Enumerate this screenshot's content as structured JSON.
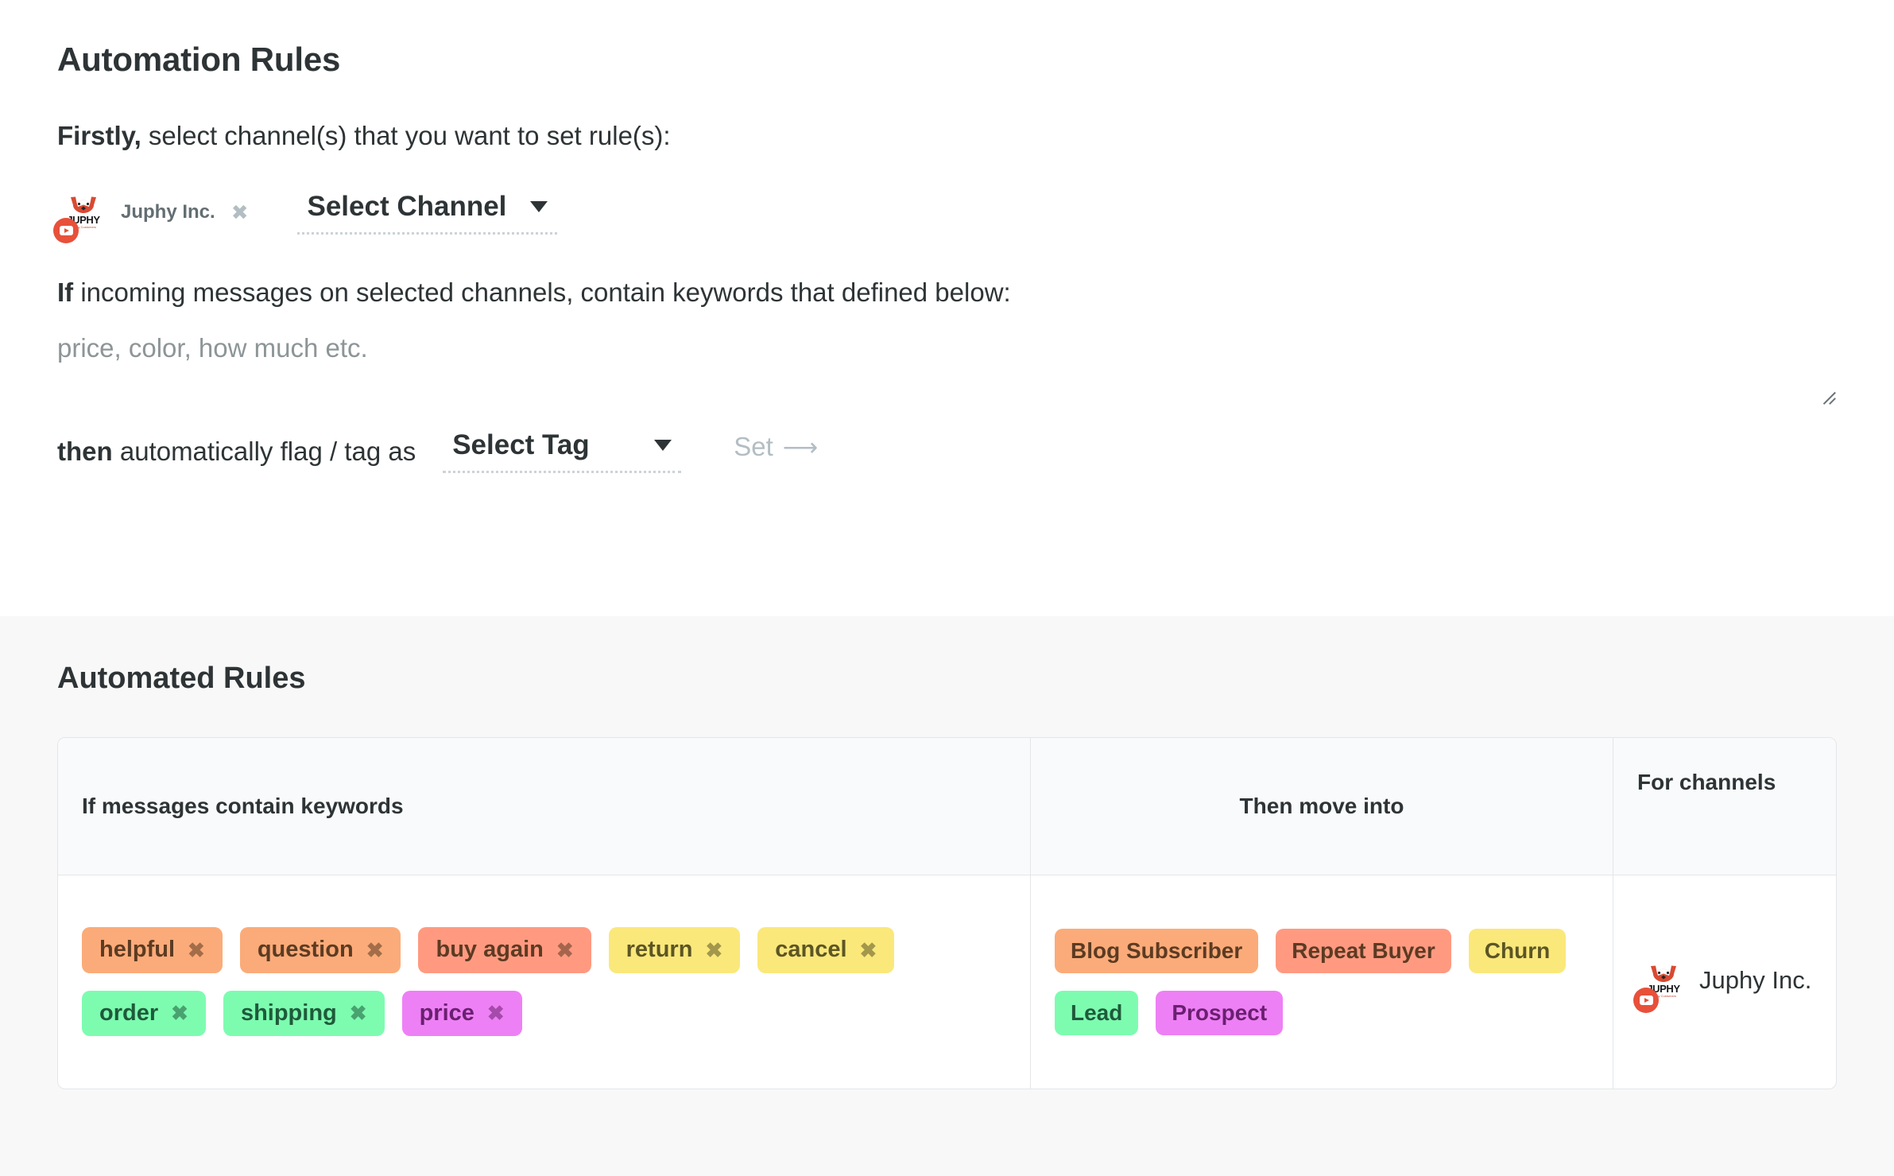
{
  "builder": {
    "title": "Automation Rules",
    "firstly": {
      "lead": "Firstly,",
      "rest": " select channel(s) that you want to set rule(s):"
    },
    "selected_channel": {
      "name": "Juphy Inc.",
      "remove_icon": "close-icon",
      "platform": "youtube",
      "logo_wordmark": "JUPHY",
      "logo_tagline": "Happy Customers"
    },
    "select_channel": {
      "label": "Select Channel",
      "caret_icon": "chevron-down-icon"
    },
    "if_line": {
      "lead": "If",
      "rest": " incoming messages on selected channels, contain keywords that defined below:"
    },
    "keywords_input": {
      "value": "",
      "placeholder": "price, color, how much etc."
    },
    "then_line": {
      "lead": "then",
      "rest": " automatically flag / tag as"
    },
    "select_tag": {
      "label": "Select Tag",
      "caret_icon": "chevron-down-icon"
    },
    "set_button": {
      "label": "Set",
      "arrow_icon": "arrow-right-icon"
    }
  },
  "results": {
    "title": "Automated Rules",
    "table": {
      "headers": [
        "If messages contain keywords",
        "Then move into",
        "For channels"
      ],
      "rows": [
        {
          "keywords": [
            {
              "label": "helpful",
              "bg": "#fbab79",
              "fg": "#5c3b22",
              "remove_icon": "close-icon"
            },
            {
              "label": "question",
              "bg": "#fbab79",
              "fg": "#5c3b22",
              "remove_icon": "close-icon"
            },
            {
              "label": "buy again",
              "bg": "#ff9a81",
              "fg": "#5c3b22",
              "remove_icon": "close-icon"
            },
            {
              "label": "return",
              "bg": "#fae87b",
              "fg": "#5c5524",
              "remove_icon": "close-icon"
            },
            {
              "label": "cancel",
              "bg": "#fae87b",
              "fg": "#5c5524",
              "remove_icon": "close-icon"
            },
            {
              "label": "order",
              "bg": "#7dfcb0",
              "fg": "#1f5a3a",
              "remove_icon": "close-icon"
            },
            {
              "label": "shipping",
              "bg": "#7dfcb0",
              "fg": "#1f5a3a",
              "remove_icon": "close-icon"
            },
            {
              "label": "price",
              "bg": "#ee80f5",
              "fg": "#6a2070",
              "remove_icon": "close-icon"
            }
          ],
          "tags": [
            {
              "label": "Blog Subscriber",
              "bg": "#fbab79",
              "fg": "#5c3b22"
            },
            {
              "label": "Repeat Buyer",
              "bg": "#ff9a81",
              "fg": "#5c3b22"
            },
            {
              "label": "Churn",
              "bg": "#fae87b",
              "fg": "#5c5524"
            },
            {
              "label": "Lead",
              "bg": "#7dfcb0",
              "fg": "#1f5a3a"
            },
            {
              "label": "Prospect",
              "bg": "#ee80f5",
              "fg": "#6a2070"
            }
          ],
          "channel": {
            "name": "Juphy Inc.",
            "platform": "youtube",
            "logo_wordmark": "JUPHY",
            "logo_tagline": "Happy Customers"
          }
        }
      ]
    }
  },
  "colors": {
    "page_bg": "#ffffff",
    "section_bg": "#f8f8f8",
    "text": "#2e3436",
    "muted": "#8d9597",
    "border": "#e4e6e8",
    "brand_red": "#e8503a"
  }
}
